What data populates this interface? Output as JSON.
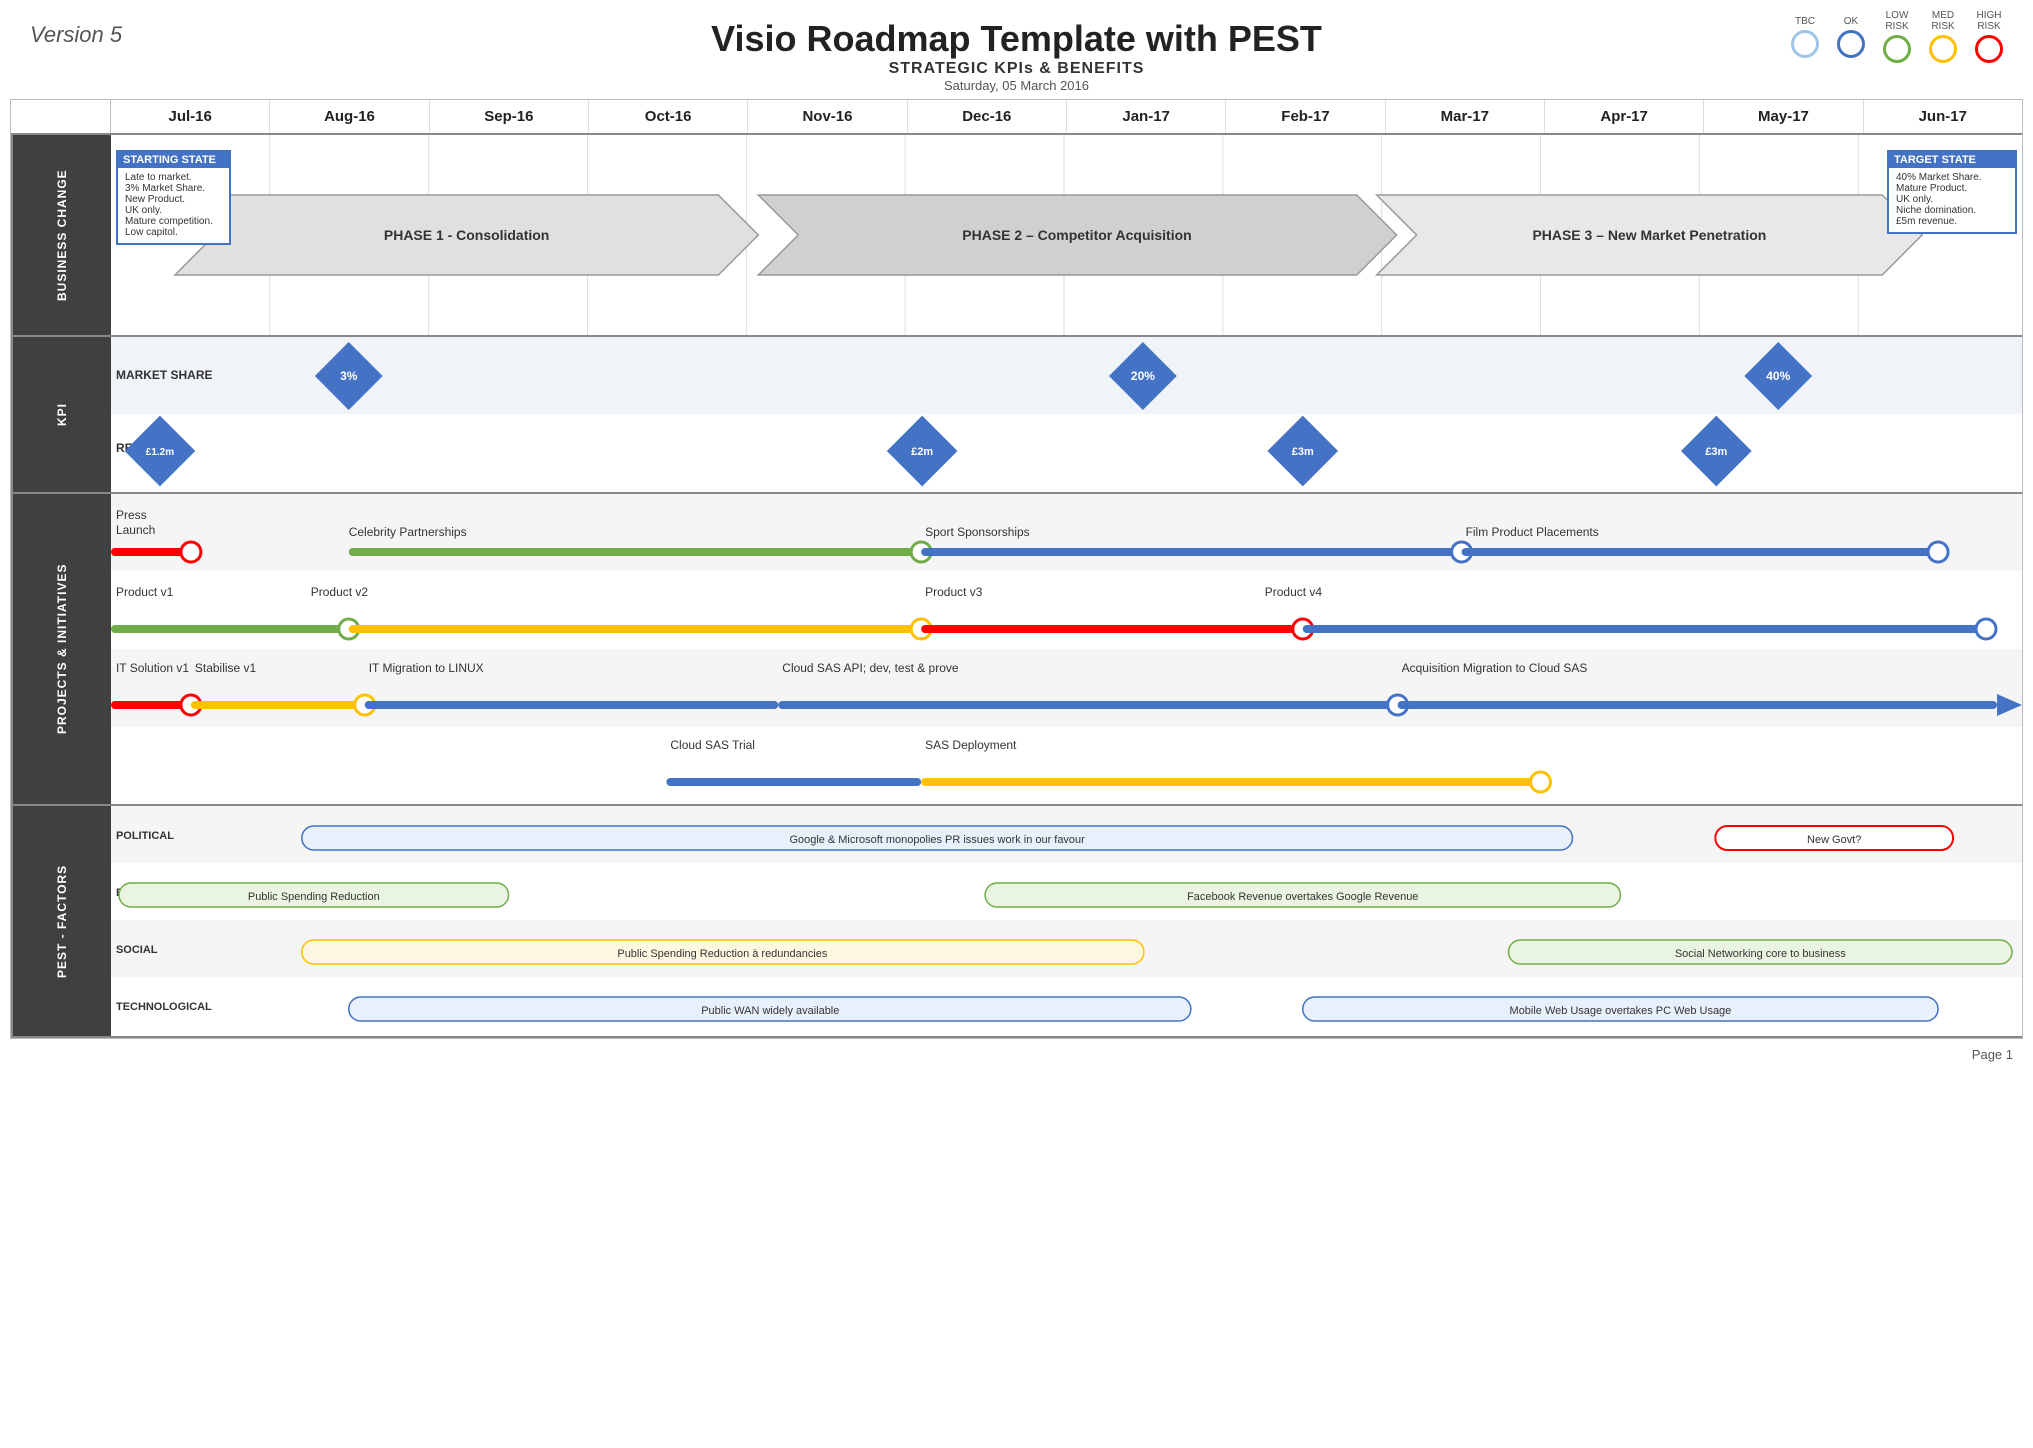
{
  "header": {
    "version": "Version 5",
    "title": "Visio Roadmap Template with PEST",
    "subtitle": "STRATEGIC KPIs & BENEFITS",
    "date": "Saturday, 05 March 2016"
  },
  "legend": {
    "items": [
      {
        "label": "TBC",
        "class": "legend-tbc"
      },
      {
        "label": "OK",
        "class": "legend-ok"
      },
      {
        "label": "LOW\nRISK",
        "class": "legend-low"
      },
      {
        "label": "MED\nRISK",
        "class": "legend-med"
      },
      {
        "label": "HIGH\nRISK",
        "class": "legend-high"
      }
    ]
  },
  "months": [
    "Jul-16",
    "Aug-16",
    "Sep-16",
    "Oct-16",
    "Nov-16",
    "Dec-16",
    "Jan-17",
    "Feb-17",
    "Mar-17",
    "Apr-17",
    "May-17",
    "Jun-17"
  ],
  "sections": {
    "business_change": {
      "label": "BUSINESS CHANGE",
      "starting_state": {
        "title": "STARTING STATE",
        "lines": [
          "Late to market.",
          "3% Market Share.",
          "New Product.",
          "UK only.",
          "Mature competition.",
          "Low capitol."
        ]
      },
      "target_state": {
        "title": "TARGET STATE",
        "lines": [
          "40% Market Share.",
          "Mature Product.",
          "UK only.",
          "Niche domination.",
          "£5m revenue."
        ]
      },
      "phases": [
        {
          "label": "PHASE 1 - Consolidation",
          "start_month": 0.4,
          "end_month": 4.2
        },
        {
          "label": "PHASE 2 – Competitor Acquisition",
          "start_month": 4.2,
          "end_month": 8.1
        },
        {
          "label": "PHASE 3 – New Market Penetration",
          "start_month": 8.1,
          "end_month": 11.4
        }
      ]
    },
    "kpi": {
      "label": "KPI",
      "rows": [
        {
          "label": "MARKET SHARE",
          "diamonds": [
            {
              "month": 1.5,
              "value": "3%"
            },
            {
              "month": 6.5,
              "value": "20%"
            },
            {
              "month": 10.5,
              "value": "40%"
            }
          ]
        },
        {
          "label": "REVENUE",
          "diamonds": [
            {
              "month": 0.3,
              "value": "£1.2m"
            },
            {
              "month": 5.1,
              "value": "£2m"
            },
            {
              "month": 7.5,
              "value": "£3m"
            },
            {
              "month": 10.1,
              "value": "£3m"
            }
          ]
        }
      ]
    },
    "projects": {
      "label": "PROJECTS & INITIATIVES",
      "rows": [
        {
          "items": [
            {
              "type": "bar",
              "label": "Press\nLaunch",
              "label_pos": "above",
              "color": "#ff0000",
              "border": "#ff0000",
              "start": 0.0,
              "end": 0.5
            },
            {
              "type": "circle",
              "pos": 0.5,
              "color": "#ff0000"
            },
            {
              "type": "bar",
              "label": "Celebrity Partnerships",
              "label_pos": "above",
              "color": "#70ad47",
              "border": "#70ad47",
              "start": 1.5,
              "end": 5.1
            },
            {
              "type": "circle",
              "pos": 5.1,
              "color": "#70ad47"
            },
            {
              "type": "bar",
              "label": "Sport Sponsorships",
              "label_pos": "above",
              "color": "#4472c4",
              "border": "#4472c4",
              "start": 5.1,
              "end": 8.5
            },
            {
              "type": "circle",
              "pos": 8.5,
              "color": "#4472c4",
              "fill": "none"
            },
            {
              "type": "bar",
              "label": "Film Product Placements",
              "label_pos": "above",
              "color": "#4472c4",
              "border": "#4472c4",
              "start": 8.5,
              "end": 11.5
            },
            {
              "type": "circle",
              "pos": 11.5,
              "color": "#4472c4",
              "fill": "none"
            }
          ]
        },
        {
          "items": [
            {
              "type": "bar",
              "label": "Product v1",
              "label_pos": "above",
              "color": "#70ad47",
              "border": "#70ad47",
              "start": 0.0,
              "end": 1.5
            },
            {
              "type": "circle",
              "pos": 1.5,
              "color": "#70ad47"
            },
            {
              "type": "bar",
              "label": "Product v2",
              "label_pos": "above",
              "color": "#ffc000",
              "border": "#ffc000",
              "start": 1.5,
              "end": 5.1
            },
            {
              "type": "circle",
              "pos": 5.1,
              "color": "#ffc000"
            },
            {
              "type": "bar",
              "label": "Product v3",
              "label_pos": "above",
              "color": "#ff0000",
              "border": "#ff0000",
              "start": 5.1,
              "end": 7.5
            },
            {
              "type": "circle",
              "pos": 7.5,
              "color": "#ff0000"
            },
            {
              "type": "bar",
              "label": "Product v4",
              "label_pos": "above",
              "color": "#4472c4",
              "border": "#4472c4",
              "start": 7.5,
              "end": 11.8
            },
            {
              "type": "circle",
              "pos": 11.8,
              "color": "#4472c4",
              "fill": "none"
            }
          ]
        },
        {
          "items": [
            {
              "type": "bar",
              "label": "IT Solution v1",
              "label_pos": "above",
              "color": "#ff0000",
              "border": "#ff0000",
              "start": 0.0,
              "end": 0.5
            },
            {
              "type": "circle",
              "pos": 0.5,
              "color": "#ff0000"
            },
            {
              "type": "bar",
              "label": "Stabilise v1",
              "label_pos": "above",
              "color": "#ffc000",
              "border": "#ffc000",
              "start": 0.5,
              "end": 1.6
            },
            {
              "type": "circle",
              "pos": 1.6,
              "color": "#ffc000"
            },
            {
              "type": "bar",
              "label": "IT Migration to LINUX",
              "label_pos": "above",
              "color": "#4472c4",
              "border": "#4472c4",
              "start": 1.6,
              "end": 4.2
            },
            {
              "type": "bar",
              "label": "Cloud SAS API; dev, test & prove",
              "label_pos": "above",
              "color": "#4472c4",
              "border": "#4472c4",
              "start": 4.2,
              "end": 8.1
            },
            {
              "type": "circle",
              "pos": 8.1,
              "color": "#4472c4",
              "fill": "none"
            },
            {
              "type": "bar",
              "label": "Acquisition Migration to Cloud SAS",
              "label_pos": "above",
              "color": "#4472c4",
              "border": "#4472c4",
              "start": 8.1,
              "end": 12.0
            },
            {
              "type": "arrow",
              "pos": 12.0,
              "color": "#4472c4"
            }
          ]
        },
        {
          "items": [
            {
              "type": "bar",
              "label": "Cloud SAS Trial",
              "label_pos": "above",
              "color": "#4472c4",
              "border": "#4472c4",
              "start": 3.5,
              "end": 5.1
            },
            {
              "type": "bar",
              "label": "SAS Deployment",
              "label_pos": "above",
              "color": "#ffc000",
              "border": "#ffc000",
              "start": 5.1,
              "end": 9.0
            },
            {
              "type": "circle",
              "pos": 9.0,
              "color": "#ffc000"
            }
          ]
        }
      ]
    },
    "pest": {
      "label": "PEST - FACTORS",
      "rows": [
        {
          "label": "POLITICAL",
          "bars": [
            {
              "label": "Google & Microsoft monopolies PR issues work in our favour",
              "start": 1.2,
              "end": 9.2,
              "color": "#4472c4",
              "bg": "#e8f0fb",
              "border": "#4472c4"
            },
            {
              "label": "New Govt?",
              "start": 10.1,
              "end": 11.6,
              "color": "#ff0000",
              "bg": "#fff",
              "border": "#ff0000"
            }
          ]
        },
        {
          "label": "ECONOMICAL",
          "bars": [
            {
              "label": "Public Spending Reduction",
              "start": 0.05,
              "end": 2.5,
              "color": "#70ad47",
              "bg": "#e9f5e1",
              "border": "#70ad47"
            },
            {
              "label": "Facebook Revenue overtakes Google Revenue",
              "start": 5.5,
              "end": 9.5,
              "color": "#70ad47",
              "bg": "#e9f5e1",
              "border": "#70ad47"
            }
          ]
        },
        {
          "label": "SOCIAL",
          "bars": [
            {
              "label": "Public Spending Reduction à redundancies",
              "start": 1.2,
              "end": 6.5,
              "color": "#ffc000",
              "bg": "#fff8e1",
              "border": "#ffc000"
            },
            {
              "label": "Social Networking core to business",
              "start": 8.8,
              "end": 12.0,
              "color": "#70ad47",
              "bg": "#e9f5e1",
              "border": "#70ad47"
            }
          ]
        },
        {
          "label": "TECHNOLOGICAL",
          "bars": [
            {
              "label": "Public WAN widely available",
              "start": 1.5,
              "end": 6.8,
              "color": "#4472c4",
              "bg": "#e8f0fb",
              "border": "#4472c4"
            },
            {
              "label": "Mobile Web Usage overtakes PC Web Usage",
              "start": 7.5,
              "end": 11.5,
              "color": "#4472c4",
              "bg": "#e8f0fb",
              "border": "#4472c4"
            }
          ]
        }
      ]
    }
  },
  "footer": {
    "page": "Page 1"
  }
}
